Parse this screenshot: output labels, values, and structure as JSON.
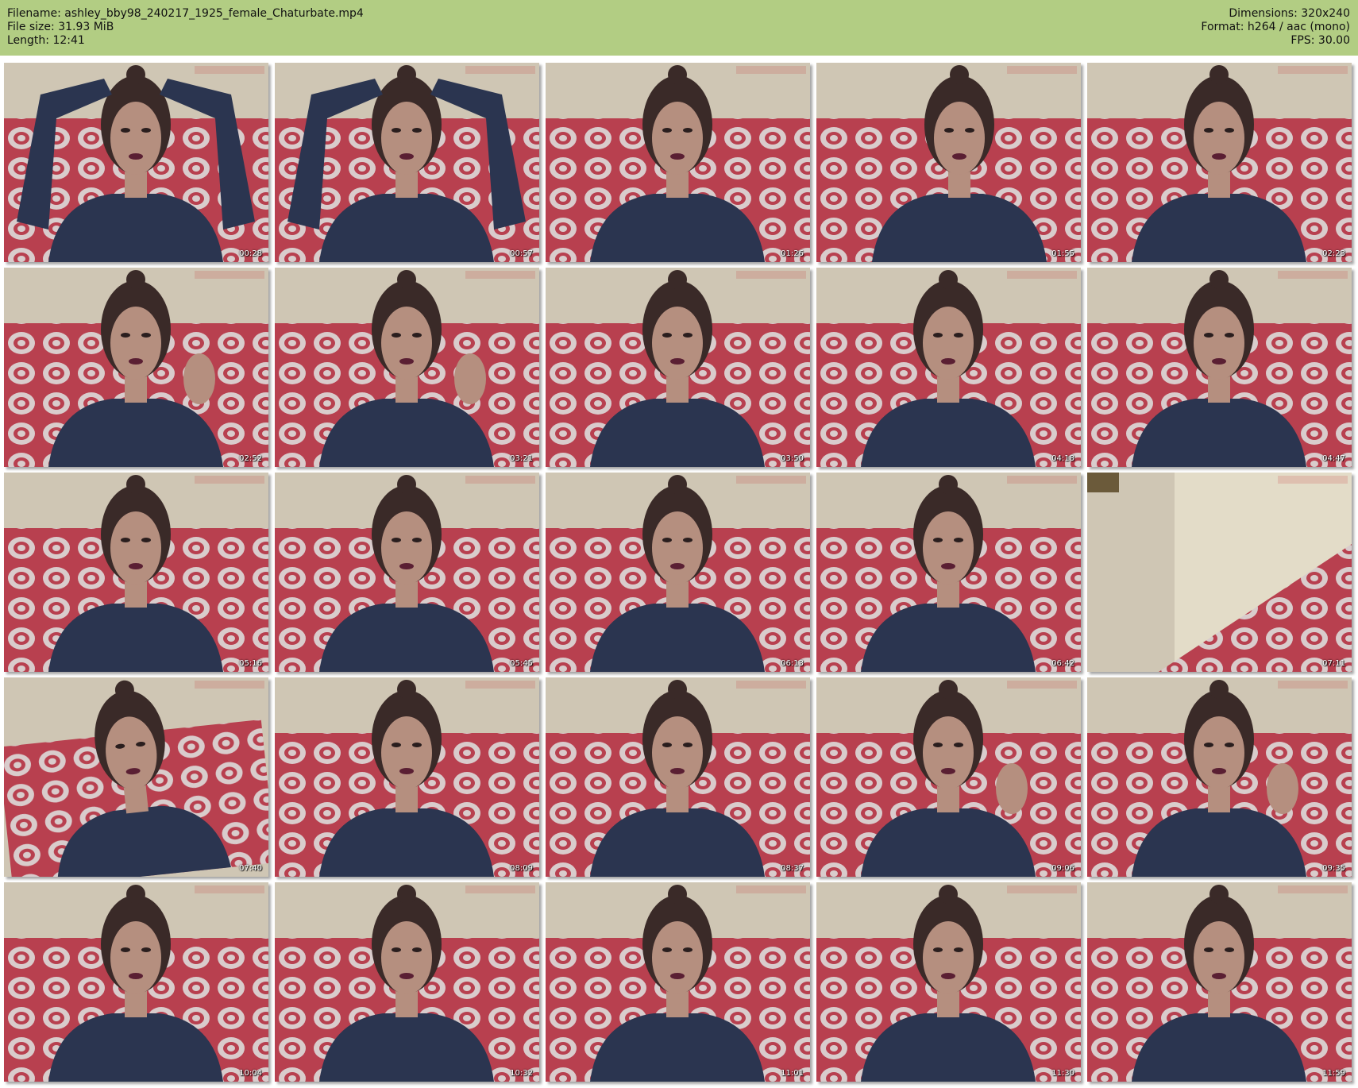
{
  "header": {
    "filename": "Filename: ashley_bby98_240217_1925_female_Chaturbate.mp4",
    "filesize": "File size: 31.93 MiB",
    "length": "Length: 12:41",
    "dimensions": "Dimensions: 320x240",
    "format": "Format: h264 / aac (mono)",
    "fps": "FPS: 30.00"
  },
  "colors": {
    "header_bg": "#b2cd83",
    "wall": "#cfc6b4",
    "sofa_red": "#b8404f",
    "sofa_light": "#d9cccc",
    "shirt": "#2b3550",
    "hair": "#3a2a28",
    "skin": "#b58f7f"
  },
  "thumbnails": [
    {
      "time": "00:28",
      "scene": "arms-up"
    },
    {
      "time": "00:57",
      "scene": "arms-up"
    },
    {
      "time": "01:26",
      "scene": "portrait"
    },
    {
      "time": "01:55",
      "scene": "turned"
    },
    {
      "time": "02:23",
      "scene": "portrait"
    },
    {
      "time": "02:52",
      "scene": "hand"
    },
    {
      "time": "03:21",
      "scene": "hand"
    },
    {
      "time": "03:50",
      "scene": "portrait"
    },
    {
      "time": "04:18",
      "scene": "portrait"
    },
    {
      "time": "04:47",
      "scene": "portrait"
    },
    {
      "time": "05:16",
      "scene": "portrait"
    },
    {
      "time": "05:45",
      "scene": "portrait"
    },
    {
      "time": "06:13",
      "scene": "portrait"
    },
    {
      "time": "06:42",
      "scene": "portrait"
    },
    {
      "time": "07:11",
      "scene": "empty"
    },
    {
      "time": "07:40",
      "scene": "tilted"
    },
    {
      "time": "08:09",
      "scene": "portrait"
    },
    {
      "time": "08:37",
      "scene": "portrait"
    },
    {
      "time": "09:06",
      "scene": "hand"
    },
    {
      "time": "09:35",
      "scene": "hand"
    },
    {
      "time": "10:04",
      "scene": "portrait"
    },
    {
      "time": "10:32",
      "scene": "portrait"
    },
    {
      "time": "11:01",
      "scene": "portrait"
    },
    {
      "time": "11:30",
      "scene": "portrait"
    },
    {
      "time": "11:59",
      "scene": "portrait"
    }
  ]
}
